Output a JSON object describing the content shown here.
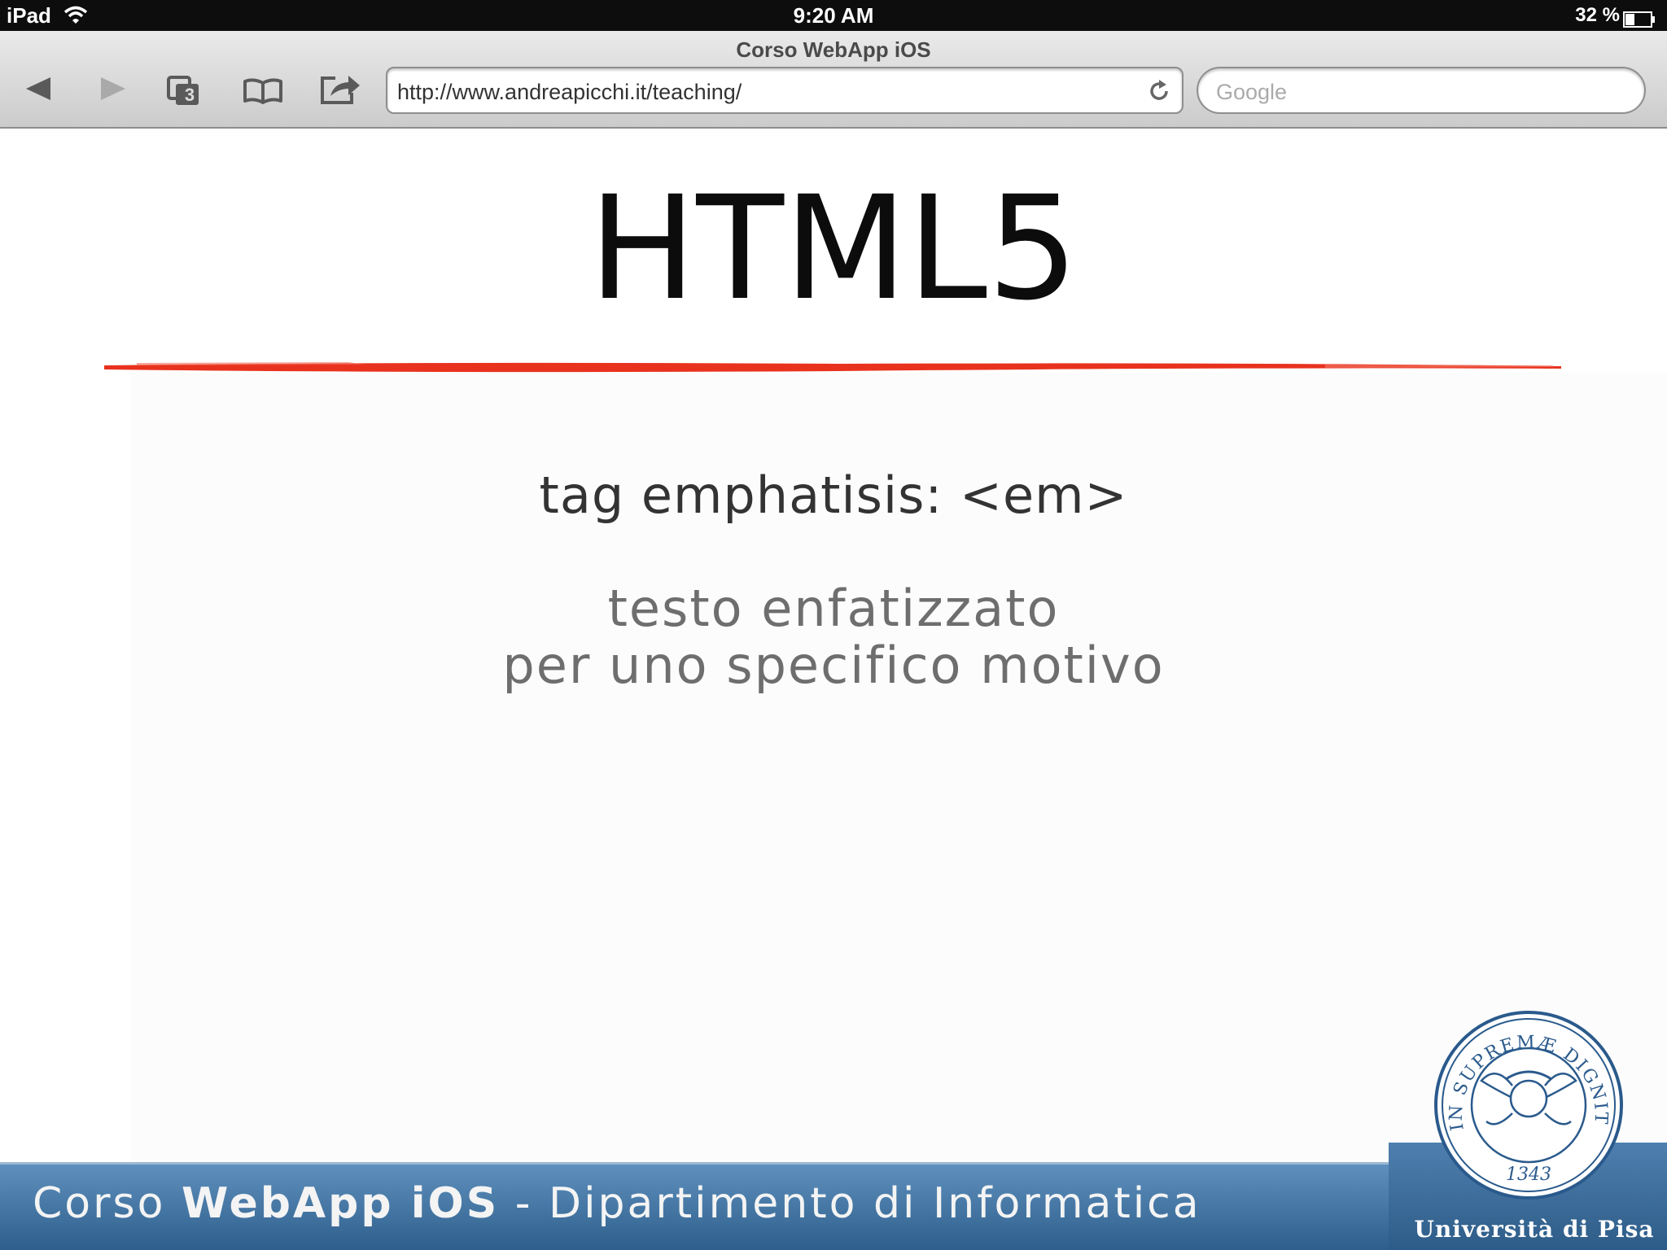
{
  "status_bar": {
    "device": "iPad",
    "time": "9:20 AM",
    "battery_percent": "32 %"
  },
  "browser": {
    "page_title": "Corso WebApp iOS",
    "url": "http://www.andreapicchi.it/teaching/",
    "search_placeholder": "Google",
    "tabs_count": "3"
  },
  "slide": {
    "title": "HTML5",
    "subtitle": "tag emphatisis: <em>",
    "body_lines": [
      "testo enfatizzato",
      "per uno specifico motivo"
    ],
    "accent_color": "#e8321e"
  },
  "footer": {
    "prefix": "Corso ",
    "bold": "WebApp iOS",
    "suffix": " - Dipartimento di Informatica",
    "seal_motto": "IN SUPREMÆ DIGNITATIS",
    "seal_year": "1343",
    "university": "Università di Pisa"
  }
}
